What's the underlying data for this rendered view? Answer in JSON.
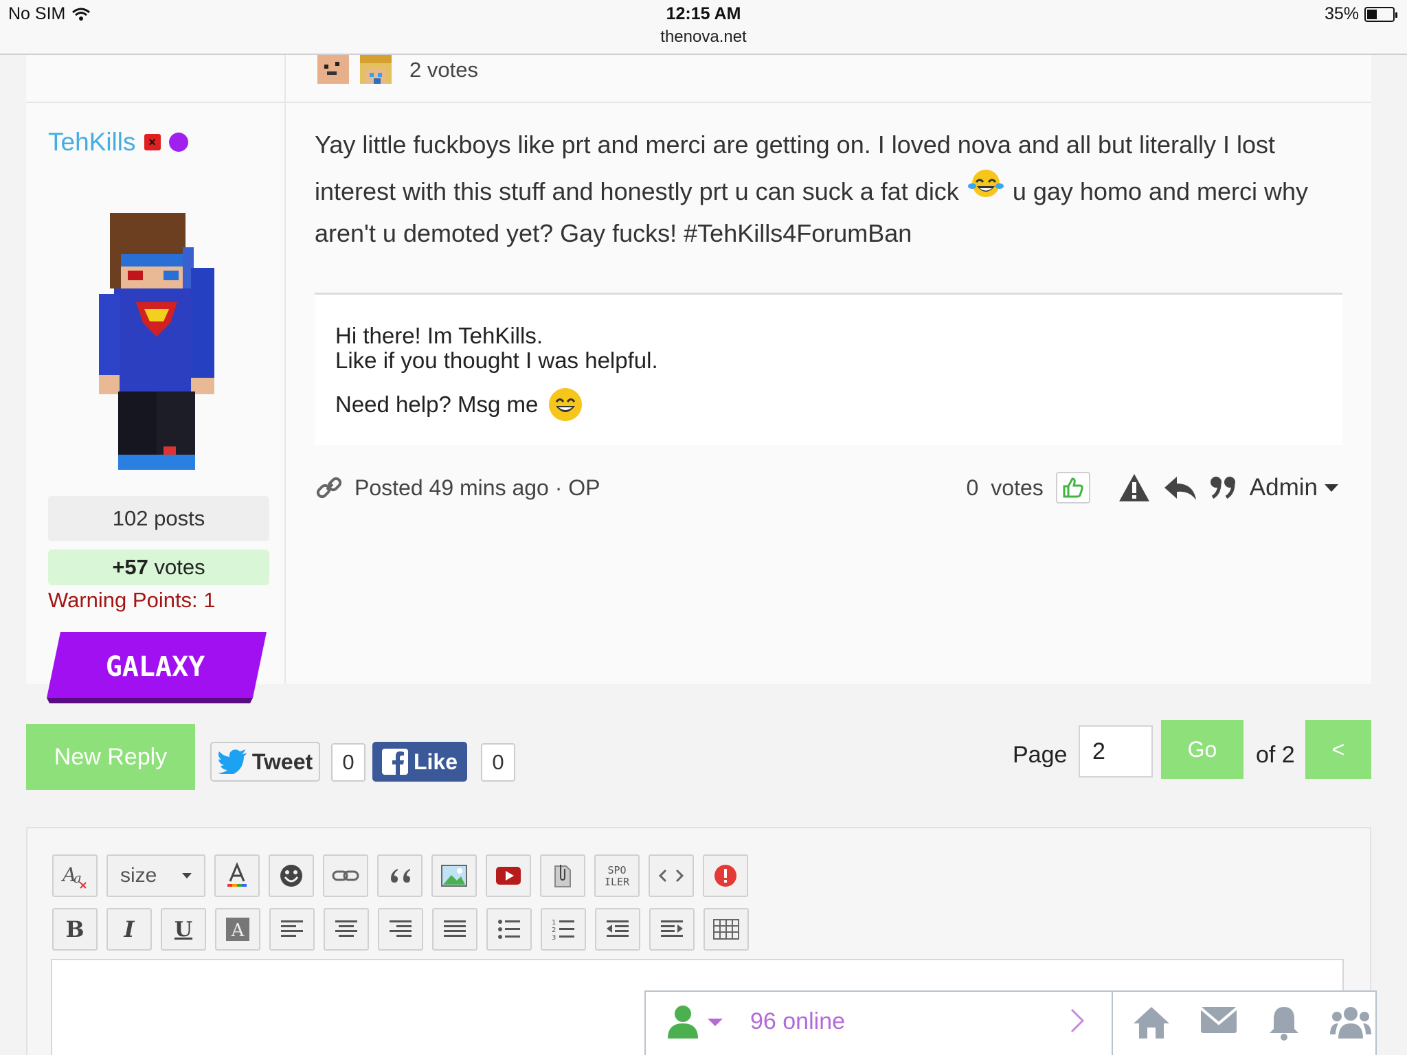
{
  "status_bar": {
    "carrier": "No SIM",
    "time": "12:15 AM",
    "url": "thenova.net",
    "battery": "35%"
  },
  "previous_post": {
    "votes": "2 votes"
  },
  "author": {
    "name": "TehKills",
    "posts": "102 posts",
    "votes_value": "+57",
    "votes_label": "votes",
    "warning": "Warning Points: 1",
    "rank": "GALAXY"
  },
  "post": {
    "text_part1": "Yay little fuckboys like prt and merci are getting on. I loved nova and all but literally I lost interest with this stuff and honestly prt u can suck a fat dick",
    "text_part2": "u gay homo and merci why aren't u demoted yet? Gay fucks! #TehKills4ForumBan",
    "signature_line1": "Hi there! Im TehKills.",
    "signature_line2": "Like if you thought I was helpful.",
    "signature_line3": "Need help? Msg me",
    "posted": "Posted 49 mins ago · OP",
    "vote_count": "0",
    "votes_label": "votes",
    "admin_label": "Admin"
  },
  "reply_bar": {
    "new_reply": "New Reply",
    "tweet": "Tweet",
    "tweet_count": "0",
    "like": "Like",
    "like_count": "0",
    "page_label": "Page",
    "page_value": "2",
    "go": "Go",
    "of_label": "of 2",
    "prev": "<"
  },
  "editor": {
    "size_label": "size",
    "spoiler_label": "SPO ILER"
  },
  "online_bar": {
    "online": "96 online"
  },
  "colors": {
    "accent_green": "#8ee07a",
    "username_blue": "#45aee0",
    "warning_red": "#a31515",
    "online_purple": "#b36ad6",
    "rank_purple": "#a010f0"
  }
}
